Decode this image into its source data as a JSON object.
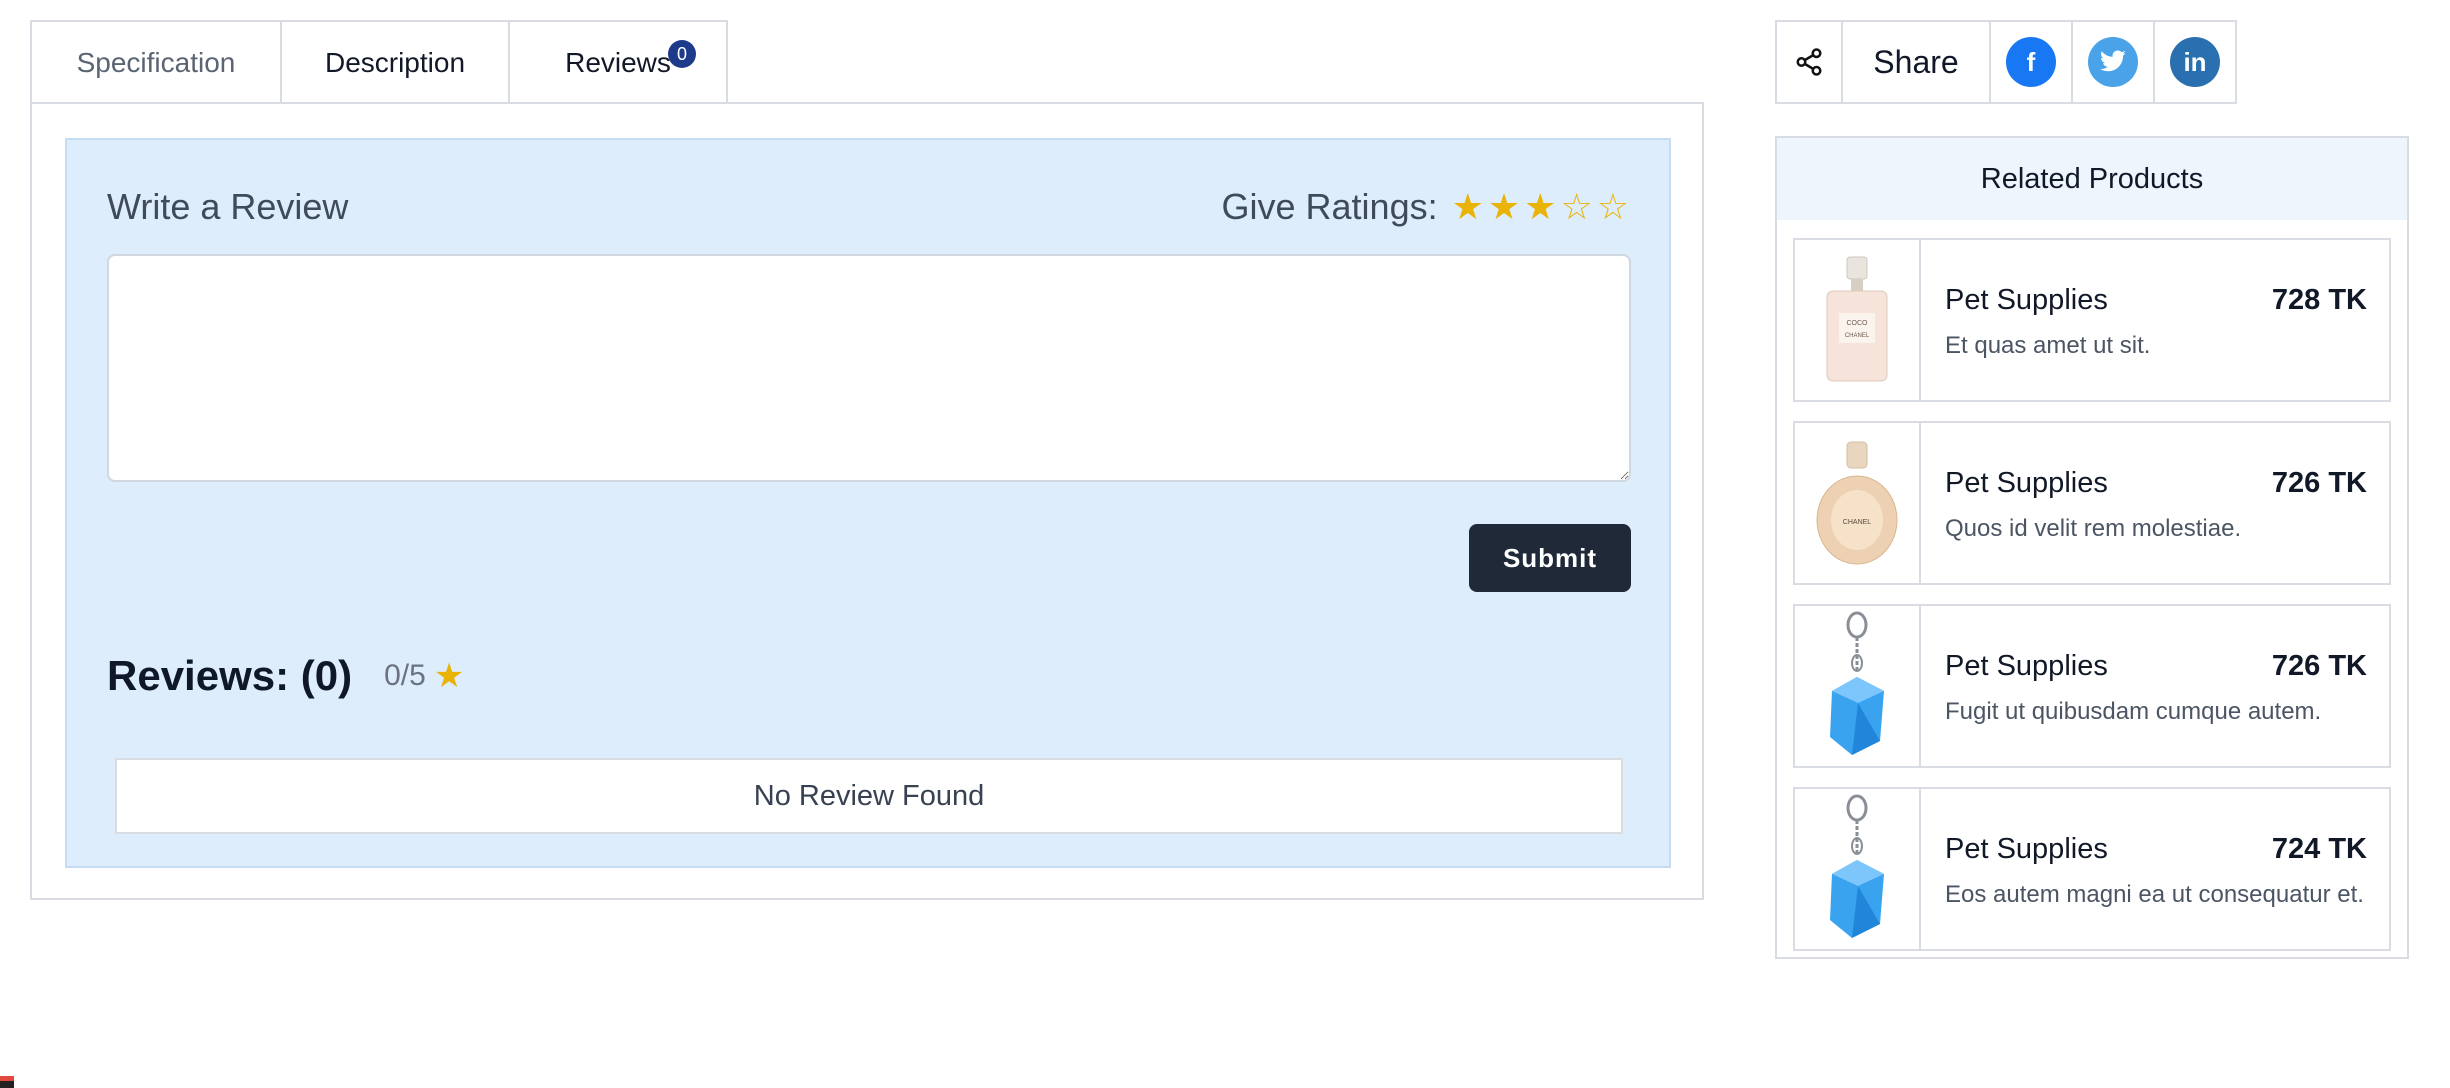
{
  "tabs": [
    {
      "label": "Specification"
    },
    {
      "label": "Description"
    },
    {
      "label": "Reviews",
      "badge": "0"
    }
  ],
  "review_form": {
    "title": "Write a Review",
    "ratings_label": "Give Ratings:",
    "rating_value": 3,
    "rating_max": 5,
    "textarea_value": "",
    "submit_label": "Submit"
  },
  "reviews": {
    "title": "Reviews: (0)",
    "average": "0/5",
    "empty_message": "No Review Found"
  },
  "share": {
    "label": "Share",
    "icons": [
      "share-icon",
      "facebook-icon",
      "twitter-icon",
      "linkedin-icon"
    ]
  },
  "related": {
    "title": "Related Products",
    "products": [
      {
        "name": "Pet Supplies",
        "price": "728 TK",
        "desc": "Et quas amet ut sit.",
        "image": "perfume-bottle-pink"
      },
      {
        "name": "Pet Supplies",
        "price": "726 TK",
        "desc": "Quos id velit rem molestiae.",
        "image": "perfume-bottle-round"
      },
      {
        "name": "Pet Supplies",
        "price": "726 TK",
        "desc": "Fugit ut quibusdam cumque autem.",
        "image": "blue-cube-keychain"
      },
      {
        "name": "Pet Supplies",
        "price": "724 TK",
        "desc": "Eos autem magni ea ut consequatur et.",
        "image": "blue-cube-keychain"
      }
    ]
  },
  "colors": {
    "review_bg": "#deedfb",
    "star": "#eab308",
    "badge": "#1e3a8a",
    "submit_bg": "#1f2937",
    "facebook": "#1877f2",
    "twitter": "#4aa3e8",
    "linkedin": "#2a6fb0"
  }
}
